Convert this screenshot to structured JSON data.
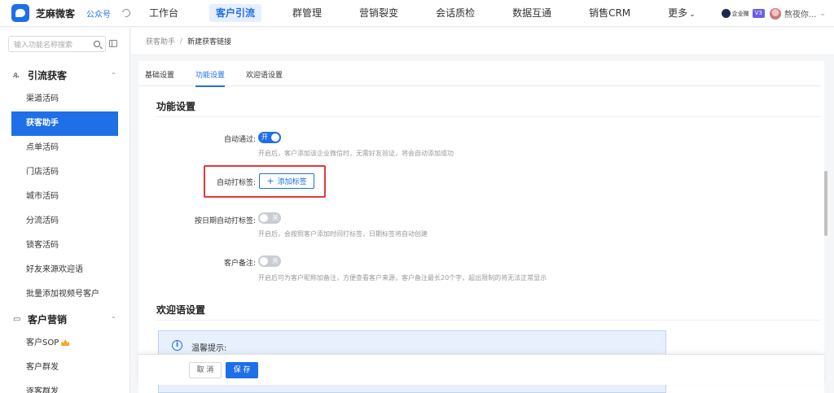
{
  "brand": {
    "name": "芝麻微客",
    "mp_label": "公众号"
  },
  "nav": {
    "items": [
      "工作台",
      "客户引流",
      "群管理",
      "营销裂变",
      "会话质检",
      "数据互通",
      "销售CRM",
      "更多"
    ],
    "active_index": 1
  },
  "user": {
    "ent_label": "企业微",
    "version": "V3",
    "name": "熬夜你..."
  },
  "sidebar": {
    "search_placeholder": "输入功能名称搜索",
    "groups": [
      {
        "label": "引流获客",
        "items": [
          "渠道活码",
          "获客助手",
          "点单活码",
          "门店活码",
          "城市活码",
          "分流活码",
          "锁客活码",
          "好友来源欢迎语",
          "批量添加视频号客户"
        ]
      },
      {
        "label": "客户营销",
        "items": [
          "客户SOP",
          "客户群发",
          "逐客群发"
        ]
      }
    ],
    "active_item": "获客助手"
  },
  "breadcrumb": {
    "parent": "获客助手",
    "sep": "/",
    "current": "新建获客链接"
  },
  "tabs": [
    "基础设置",
    "功能设置",
    "欢迎语设置"
  ],
  "active_tab": "功能设置",
  "function_settings": {
    "title": "功能设置",
    "auto_pass": {
      "label": "自动通过:",
      "state": "开",
      "on": true,
      "help": "开启后，客户添加该企业微信时，无需好友验证，将会自动添加成功"
    },
    "auto_tag": {
      "label": "自动打标签:",
      "button": "添加标签"
    },
    "date_tag": {
      "label": "按日期自动打标签:",
      "state": "关",
      "on": false,
      "help": "开启后，会按照客户添加时间打标签，日期标签将自动创建"
    },
    "remark": {
      "label": "客户备注:",
      "state": "关",
      "on": false,
      "help": "开启后可为客户昵称加备注，方便查看客户来源，客户备注最长20个字，超出限制的将无法正常显示"
    }
  },
  "welcome_settings": {
    "title": "欢迎语设置",
    "notice_title": "温馨提示:"
  },
  "footer": {
    "cancel": "取 消",
    "save": "保 存"
  }
}
